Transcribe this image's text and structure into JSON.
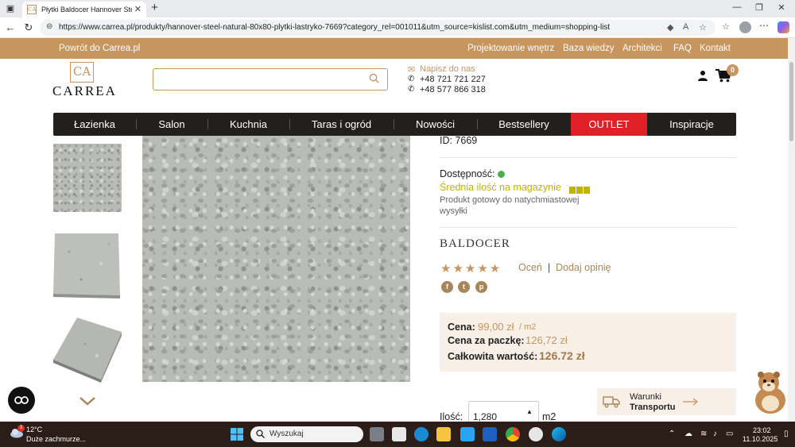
{
  "browser": {
    "tab_title": "Płytki Baldocer Hannover Steel Natural",
    "url": "https://www.carrea.pl/produkty/hannover-steel-natural-80x80-plytki-lastryko-7669?category_rel=001011&utm_source=kislist.com&utm_medium=shopping-list",
    "favicon_text": "CA"
  },
  "topbar": {
    "back_label": "Powrót do Carrea.pl",
    "links": [
      "Projektowanie wnętrz",
      "Baza wiedzy",
      "Architekci",
      "FAQ",
      "Kontakt"
    ]
  },
  "header": {
    "logo_mark": "CA",
    "logo_text": "CARREA",
    "search_value": "",
    "contact_email_label": "Napisz do nas",
    "phones": [
      "+48 721 721 227",
      "+48 577 866 318"
    ],
    "cart_count": "0"
  },
  "nav": {
    "items": [
      "Łazienka",
      "Salon",
      "Kuchnia",
      "Taras i ogród",
      "Nowości",
      "Bestsellery",
      "OUTLET",
      "Inspiracje"
    ]
  },
  "product": {
    "id_text": "ID: 7669",
    "availability_label": "Dostępność:",
    "stock_text": "Średnia ilość na magazynie",
    "ready_text": "Produkt gotowy do natychmiastowej wysyłki",
    "brand": "BALDOCER",
    "stars": "★★★★★",
    "rate_label": "Oceń",
    "rate_sep": "|",
    "review_label": "Dodaj opinię",
    "social": [
      "f",
      "t",
      "p"
    ],
    "price": {
      "price_label": "Cena:",
      "price_value": "99,00 zł",
      "price_unit": "/ m2",
      "pack_label": "Cena za paczkę:",
      "pack_value": "126,72 zł",
      "total_label": "Całkowita wartość:",
      "total_value": "126.72 zł"
    },
    "qty_label": "Ilość:",
    "qty_value": "1,280",
    "qty_unit": "m2",
    "transport_line1": "Warunki",
    "transport_line2": "Transportu"
  },
  "taskbar": {
    "weather_temp": "12°C",
    "weather_desc": "Duże zachmurze...",
    "weather_badge": "3",
    "search_placeholder": "Wyszukaj",
    "time": "23:02",
    "date": "11.10.2025"
  },
  "colors": {
    "accent": "#c8955f",
    "nav_bg": "#231f1c",
    "outlet": "#e01f26",
    "stock": "#c2b300",
    "price_box": "#f8efe6",
    "taskbar": "#2b1d18"
  }
}
